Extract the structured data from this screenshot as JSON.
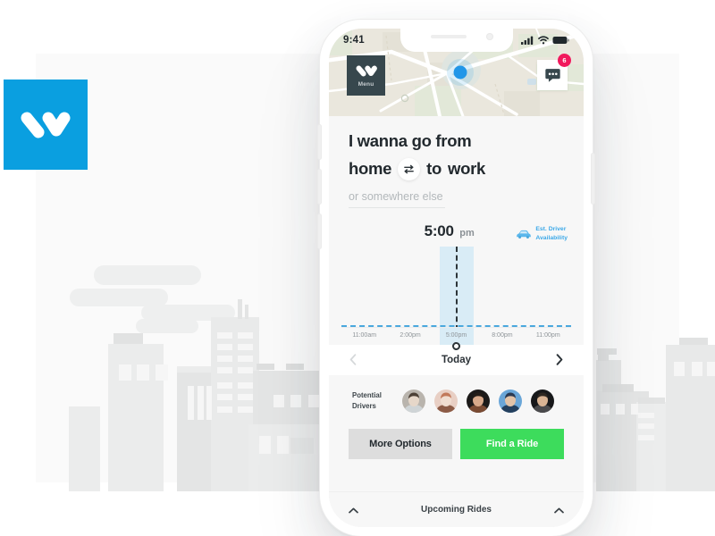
{
  "brand": {
    "logo_icon": "w-logo-icon",
    "logo_color": "#0a9fe0"
  },
  "phone": {
    "statusbar": {
      "time": "9:41",
      "signal_icon": "signal-bars-icon",
      "wifi_icon": "wifi-icon",
      "battery_icon": "battery-full-icon"
    },
    "map": {
      "menu_button": {
        "label": "Menu",
        "icon": "w-logo-icon"
      },
      "chat_button": {
        "icon": "chat-bubble-icon",
        "badge": "6",
        "badge_color": "#f1195c"
      },
      "location_dot_icon": "current-location-dot-icon"
    },
    "form": {
      "headline_line1": "I wanna go from",
      "origin": "home",
      "connector": "to",
      "destination": "work",
      "swap_icon": "swap-arrows-icon",
      "somewhere_else_placeholder": "or somewhere else",
      "somewhere_else_value": ""
    },
    "time_picker": {
      "selected_time": "5:00",
      "selected_meridiem": "pm",
      "availability_label_line1": "Est. Driver",
      "availability_label_line2": "Availability",
      "availability_icon": "car-icon",
      "availability_color": "#3da9e8",
      "handle_icon": "slider-handle-icon"
    },
    "day_nav": {
      "prev_icon": "chevron-left-icon",
      "label": "Today",
      "next_icon": "chevron-right-icon"
    },
    "drivers": {
      "label_line1": "Potential",
      "label_line2": "Drivers",
      "avatars": [
        {
          "name": "driver-avatar-1",
          "bg": "#b9b4ad",
          "skin": "#e6d7c9",
          "hair": "#4c4036",
          "shirt": "#cfd4d6"
        },
        {
          "name": "driver-avatar-2",
          "bg": "#e8cfc4",
          "skin": "#f0ddd0",
          "hair": "#c2795a",
          "shirt": "#8c5b46"
        },
        {
          "name": "driver-avatar-3",
          "bg": "#1c1a19",
          "skin": "#d8a98a",
          "hair": "#241d18",
          "shirt": "#7a4b33"
        },
        {
          "name": "driver-avatar-4",
          "bg": "#6aa6d8",
          "skin": "#e2c3a8",
          "hair": "#2b3a52",
          "shirt": "#24405e"
        },
        {
          "name": "driver-avatar-5",
          "bg": "#17181a",
          "skin": "#d9b393",
          "hair": "#2e2721",
          "shirt": "#4a4a4c"
        }
      ]
    },
    "actions": {
      "secondary_label": "More Options",
      "primary_label": "Find a Ride",
      "primary_color": "#3ddc5c",
      "secondary_color": "#dddddd"
    },
    "upcoming": {
      "left_icon": "chevron-up-icon",
      "label": "Upcoming Rides",
      "right_icon": "chevron-up-icon"
    }
  },
  "chart_data": {
    "type": "area",
    "title": "Est. Driver Availability",
    "xlabel": "",
    "ylabel": "",
    "grid": false,
    "legend": "top-right",
    "x": [
      "11:00am",
      "2:00pm",
      "5:00pm",
      "8:00pm",
      "11:00pm"
    ],
    "tick_labels": [
      "11:00am",
      "2:00pm",
      "5:00pm",
      "8:00pm",
      "11:00pm"
    ],
    "axis_range": [
      "11:00am",
      "11:00pm"
    ],
    "selected_x": "5:00pm",
    "selected_band_label": "5:00 pm",
    "series": [
      {
        "name": "Est. Driver Availability",
        "values": [
          0,
          0,
          0,
          0,
          0
        ],
        "color": "#4aa8dd",
        "style": "dashed-baseline"
      }
    ],
    "annotations": [
      {
        "type": "vertical-marker",
        "x": "5:00pm",
        "style": "dashed",
        "color": "#2d3539"
      },
      {
        "type": "highlight-band",
        "x": "5:00pm",
        "color": "#cfe8f5"
      }
    ]
  }
}
